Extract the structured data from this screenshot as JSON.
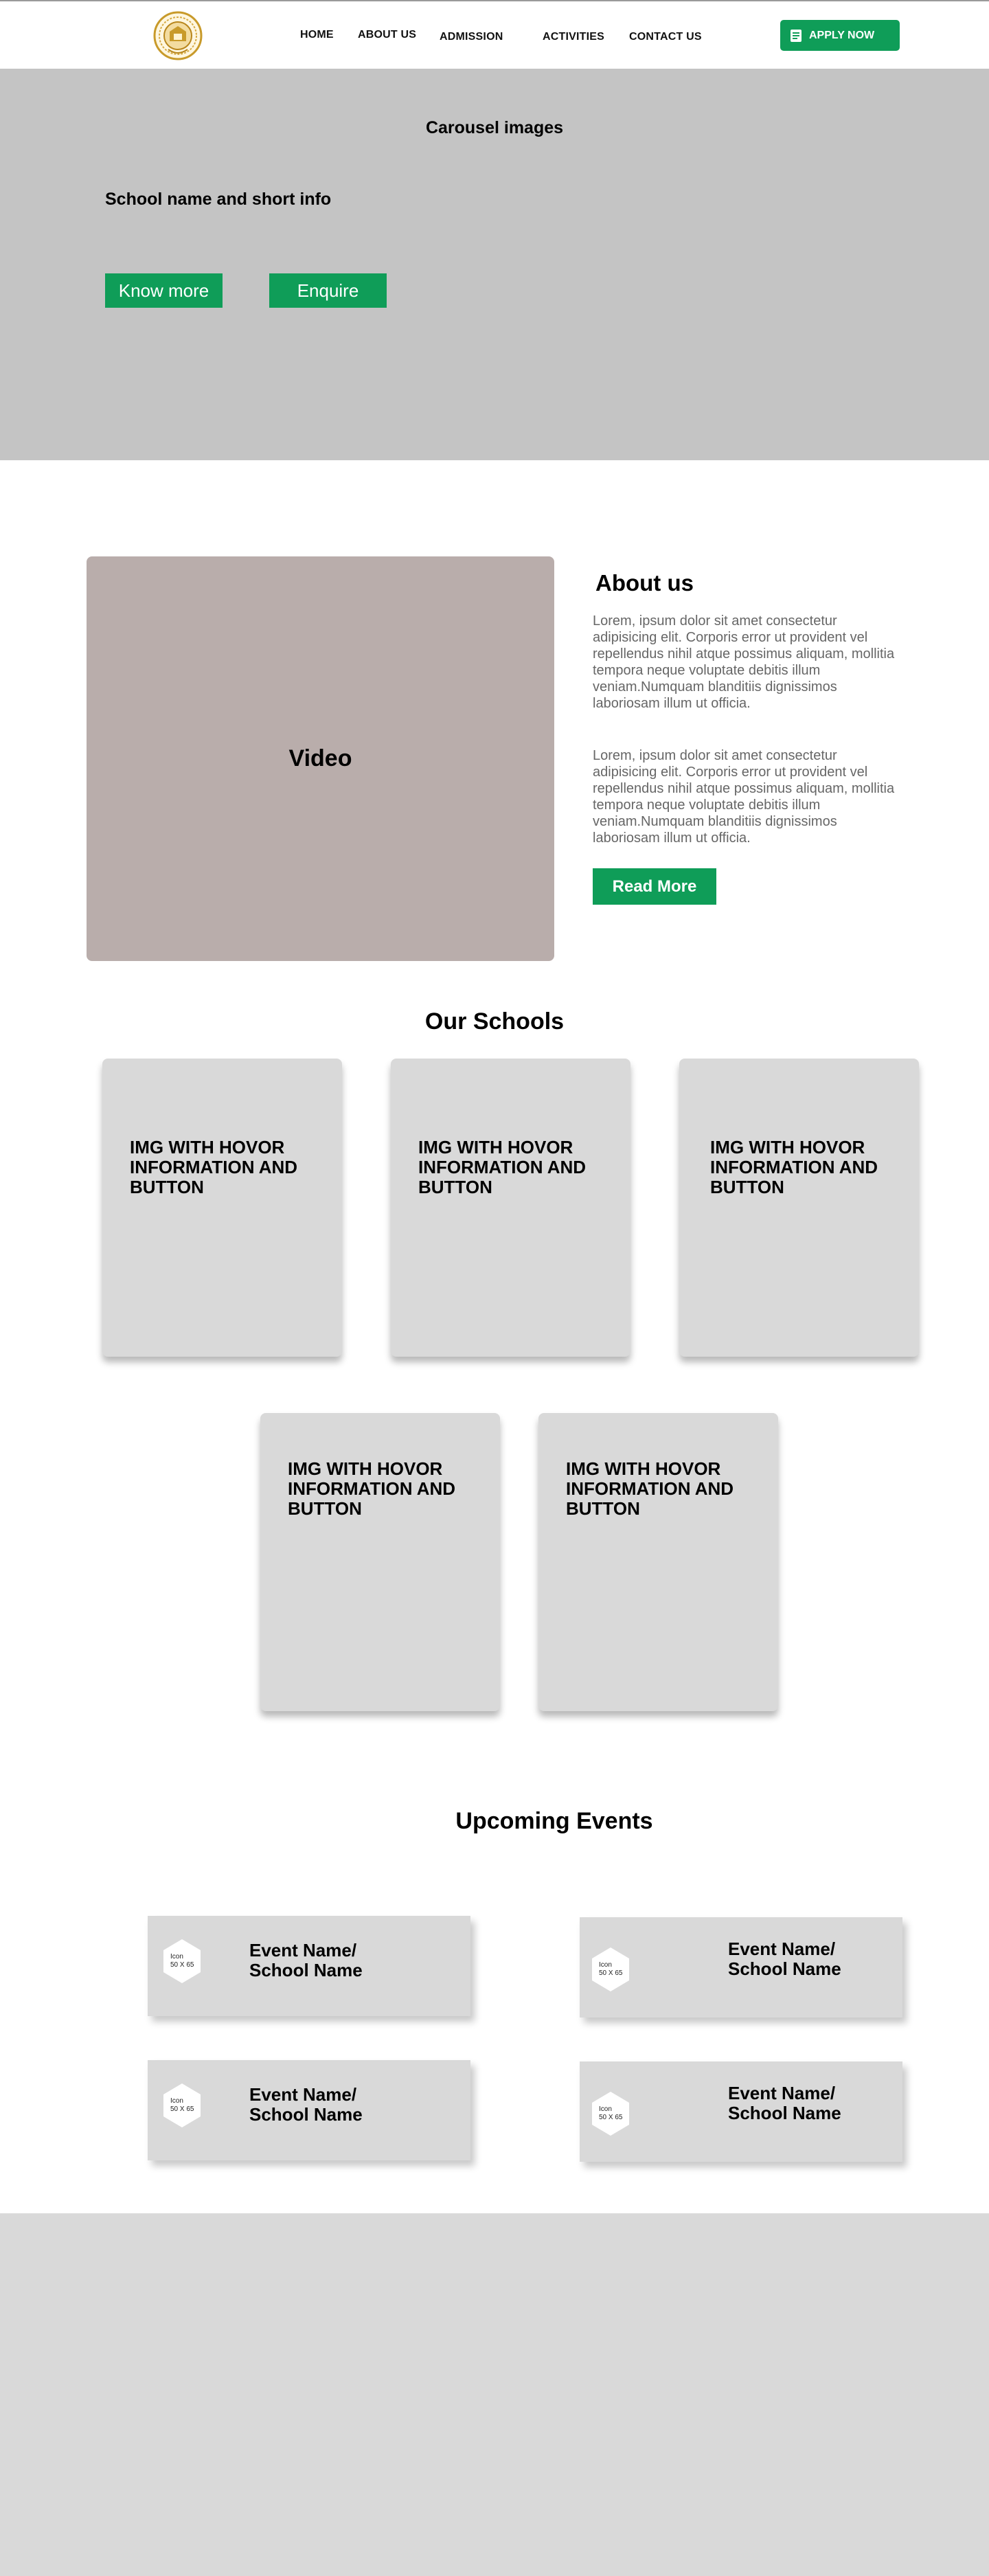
{
  "colors": {
    "accent_green": "#0f9d58",
    "hero_bg": "#c4c4c4",
    "video_bg": "#b9adab",
    "card_bg": "#d9d9d9",
    "footer_bg": "#d9d9d9",
    "body_text_gray": "#666666"
  },
  "header": {
    "logo_icon": "school-crest-logo",
    "nav": {
      "home": "HOME",
      "about": "ABOUT US",
      "admission": "ADMISSION",
      "activities": "ACTIVITIES",
      "contact": "CONTACT US"
    },
    "apply": {
      "label": "APPLY NOW",
      "icon": "form-icon"
    }
  },
  "hero": {
    "title": "Carousel images",
    "subtitle": "School name and short info",
    "know_more": "Know more",
    "enquire": "Enquire"
  },
  "about": {
    "video_label": "Video",
    "title": "About us",
    "para1": "Lorem, ipsum dolor sit amet consectetur adipisicing elit. Corporis error ut provident vel repellendus nihil atque possimus aliquam, mollitia tempora neque voluptate debitis illum veniam.Numquam blanditiis dignissimos laboriosam illum ut officia.",
    "para2": "Lorem, ipsum dolor sit amet consectetur adipisicing elit. Corporis error ut provident vel repellendus nihil atque possimus aliquam, mollitia tempora neque voluptate debitis illum veniam.Numquam blanditiis dignissimos laboriosam illum ut officia.",
    "read_more": "Read More"
  },
  "schools": {
    "title": "Our Schools",
    "cards": [
      {
        "text": "IMG WITH HOVOR INFORMATION AND BUTTON"
      },
      {
        "text": "IMG WITH HOVOR INFORMATION AND BUTTON"
      },
      {
        "text": "IMG WITH HOVOR INFORMATION AND BUTTON"
      },
      {
        "text": "IMG WITH HOVOR INFORMATION AND BUTTON"
      },
      {
        "text": "IMG WITH HOVOR INFORMATION AND BUTTON"
      }
    ]
  },
  "events": {
    "title": "Upcoming Events",
    "items": [
      {
        "icon_label": "Icon",
        "icon_size": "50 X 65",
        "name": "Event Name/",
        "school": "School Name"
      },
      {
        "icon_label": "Icon",
        "icon_size": "50 X 65",
        "name": "Event Name/",
        "school": "School Name"
      },
      {
        "icon_label": "Icon",
        "icon_size": "50 X 65",
        "name": "Event Name/",
        "school": "School Name"
      },
      {
        "icon_label": "Icon",
        "icon_size": "50 X 65",
        "name": "Event Name/",
        "school": "School Name"
      }
    ]
  }
}
